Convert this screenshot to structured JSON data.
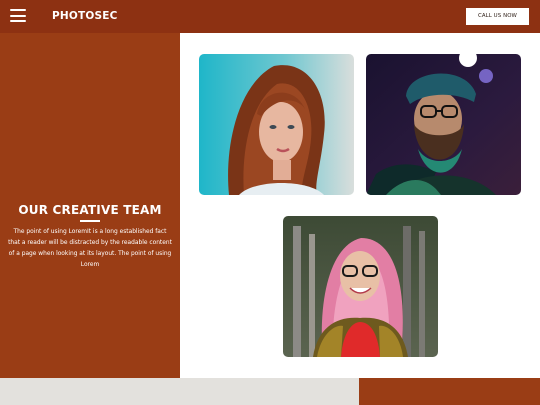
{
  "header": {
    "brand": "PHOTOSEC",
    "cta_label": "CALL US NOW",
    "background": "#8d3112"
  },
  "team": {
    "title": "OUR CREATIVE TEAM",
    "description": "The point of using LoremIt is a long established fact that a reader will be distracted by the readable content of a page when looking at its layout. The point of using Lorem",
    "panel_color": "#9a3d15"
  },
  "photos": [
    {
      "icon": "woman-portrait"
    },
    {
      "icon": "bearded-man-portrait"
    },
    {
      "icon": "smiling-woman-portrait"
    }
  ],
  "colors": {
    "accent": "#9a3d15",
    "footer_left": "#e3e1dd"
  }
}
